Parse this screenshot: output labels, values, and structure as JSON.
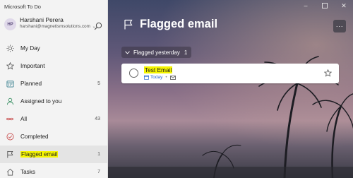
{
  "app": {
    "title": "Microsoft To Do"
  },
  "profile": {
    "initials": "HP",
    "name": "Harshani Perera",
    "email": "harshani@magnetismsolutions.com"
  },
  "sidebar": {
    "items": [
      {
        "label": "My Day",
        "count": "",
        "icon": "sun-icon"
      },
      {
        "label": "Important",
        "count": "",
        "icon": "star-icon"
      },
      {
        "label": "Planned",
        "count": "5",
        "icon": "calendar-icon"
      },
      {
        "label": "Assigned to you",
        "count": "",
        "icon": "person-icon"
      },
      {
        "label": "All",
        "count": "43",
        "icon": "infinity-icon"
      },
      {
        "label": "Completed",
        "count": "",
        "icon": "check-circle-icon"
      },
      {
        "label": "Flagged email",
        "count": "1",
        "icon": "flag-icon",
        "selected": true
      },
      {
        "label": "Tasks",
        "count": "7",
        "icon": "home-icon"
      }
    ]
  },
  "main": {
    "title": "Flagged email",
    "group": {
      "label": "Flagged yesterday",
      "count": "1"
    },
    "task": {
      "title": "Test Email",
      "due": "Today"
    }
  },
  "colors": {
    "accent": "#2564cf",
    "highlight": "#f5f500",
    "sidebar_bg": "#f3f3f3"
  }
}
